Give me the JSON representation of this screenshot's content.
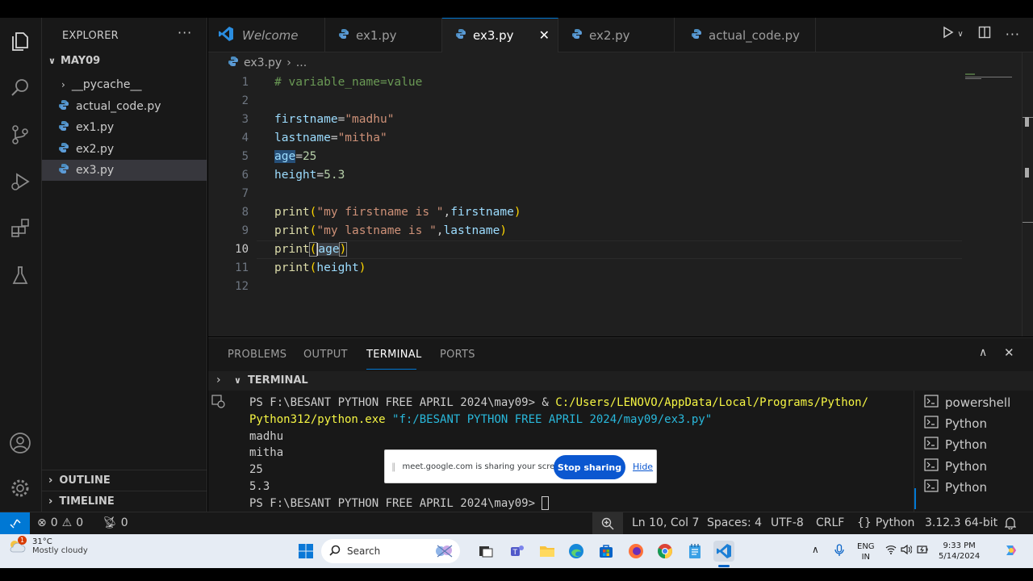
{
  "sidebar": {
    "title": "EXPLORER",
    "more": "···",
    "folder": "MAY09",
    "items": [
      {
        "label": "__pycache__",
        "type": "folder"
      },
      {
        "label": "actual_code.py",
        "type": "py"
      },
      {
        "label": "ex1.py",
        "type": "py"
      },
      {
        "label": "ex2.py",
        "type": "py"
      },
      {
        "label": "ex3.py",
        "type": "py"
      }
    ],
    "outline": "OUTLINE",
    "timeline": "TIMELINE"
  },
  "tabs": [
    {
      "label": "Welcome",
      "icon": "vscode-icon"
    },
    {
      "label": "ex1.py",
      "icon": "python-icon"
    },
    {
      "label": "ex3.py",
      "icon": "python-icon",
      "active": true
    },
    {
      "label": "ex2.py",
      "icon": "python-icon"
    },
    {
      "label": "actual_code.py",
      "icon": "python-icon"
    }
  ],
  "breadcrumb": {
    "file": "ex3.py",
    "sep": "›",
    "rest": "..."
  },
  "editor": {
    "line_numbers": [
      "1",
      "2",
      "3",
      "4",
      "5",
      "6",
      "7",
      "8",
      "9",
      "10",
      "11",
      "12"
    ],
    "active_line": "10",
    "code": {
      "l1": "# variable_name=value",
      "l3_var": "firstname",
      "l3_eq": "=",
      "l3_str": "\"madhu\"",
      "l4_var": "lastname",
      "l4_eq": "=",
      "l4_str": "\"mitha\"",
      "l5_var": "age",
      "l5_eq": "=",
      "l5_num": "25",
      "l6_var": "height",
      "l6_eq": "=",
      "l6_num": "5.3",
      "print": "print",
      "lp": "(",
      "rp": ")",
      "comma": ",",
      "l8_str": "\"my firstname is \"",
      "l8_var": "firstname",
      "l9_str": "\"my lastname is \"",
      "l9_var": "lastname",
      "l10_var_a": "a",
      "l10_var_b": "ge",
      "l11_var": "height"
    }
  },
  "panel": {
    "tabs": [
      "PROBLEMS",
      "OUTPUT",
      "TERMINAL",
      "PORTS"
    ],
    "active_tab": "TERMINAL",
    "section_title": "TERMINAL",
    "terminal": {
      "l1_prompt": "PS F:\\BESANT PYTHON FREE APRIL 2024\\may09> & ",
      "l1_path": "C:/Users/LENOVO/AppData/Local/Programs/Python/",
      "l2_path": "Python312/python.exe",
      "l2_arg": "\"f:/BESANT PYTHON FREE APRIL 2024/may09/ex3.py\"",
      "out1": "madhu",
      "out2": "mitha",
      "out3": "25",
      "out4": "5.3",
      "l7_prompt": "PS F:\\BESANT PYTHON FREE APRIL 2024\\may09> "
    },
    "terminal_list": [
      "powershell",
      "Python",
      "Python",
      "Python",
      "Python"
    ]
  },
  "share_bar": {
    "text": "meet.google.com is sharing your screen.",
    "stop": "Stop sharing",
    "hide": "Hide"
  },
  "status": {
    "errors": "0",
    "warnings": "0",
    "ports": "0",
    "position": "Ln 10, Col 7",
    "spaces": "Spaces: 4",
    "encoding": "UTF-8",
    "eol": "CRLF",
    "language": "Python",
    "interpreter": "3.12.3 64-bit"
  },
  "taskbar": {
    "weather_badge": "1",
    "temp": "31°C",
    "weather": "Mostly cloudy",
    "search": "Search",
    "lang1": "ENG",
    "lang2": "IN",
    "time": "9:33 PM",
    "date": "5/14/2024"
  },
  "colors": {
    "accent": "#0078d4",
    "editor_bg": "#1f1f1f",
    "sidebar_bg": "#181818"
  }
}
